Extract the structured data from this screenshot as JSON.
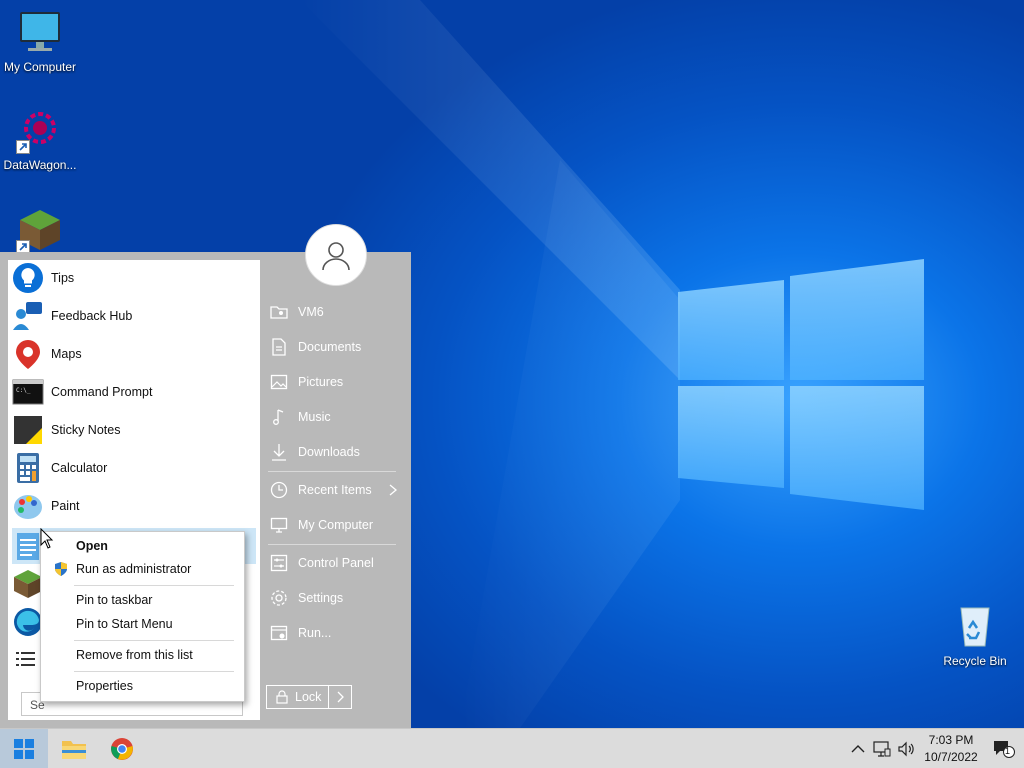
{
  "desktop": {
    "icons": [
      {
        "label": "My Computer"
      },
      {
        "label": "DataWagon..."
      },
      {
        "label": ""
      },
      {
        "label": "Recycle Bin"
      }
    ]
  },
  "start_menu": {
    "programs": [
      {
        "label": "Tips",
        "icon": "tips-icon"
      },
      {
        "label": "Feedback Hub",
        "icon": "feedback-hub-icon"
      },
      {
        "label": "Maps",
        "icon": "maps-icon"
      },
      {
        "label": "Command Prompt",
        "icon": "command-prompt-icon"
      },
      {
        "label": "Sticky Notes",
        "icon": "sticky-notes-icon"
      },
      {
        "label": "Calculator",
        "icon": "calculator-icon"
      },
      {
        "label": "Paint",
        "icon": "paint-icon"
      }
    ],
    "search_text": "Se",
    "right_items": [
      {
        "label": "VM6",
        "icon": "user-folder-icon"
      },
      {
        "label": "Documents",
        "icon": "documents-icon"
      },
      {
        "label": "Pictures",
        "icon": "pictures-icon"
      },
      {
        "label": "Music",
        "icon": "music-icon"
      },
      {
        "label": "Downloads",
        "icon": "downloads-icon"
      },
      {
        "label": "Recent Items",
        "icon": "recent-items-icon"
      },
      {
        "label": "My Computer",
        "icon": "computer-icon"
      },
      {
        "label": "Control Panel",
        "icon": "control-panel-icon"
      },
      {
        "label": "Settings",
        "icon": "settings-icon"
      },
      {
        "label": "Run...",
        "icon": "run-icon"
      }
    ],
    "lock_label": "Lock"
  },
  "context_menu": {
    "items": [
      {
        "label": "Open"
      },
      {
        "label": "Run as administrator"
      },
      {
        "label": "Pin to taskbar"
      },
      {
        "label": "Pin to Start Menu"
      },
      {
        "label": "Remove from this list"
      },
      {
        "label": "Properties"
      }
    ]
  },
  "taskbar": {
    "time": "7:03 PM",
    "date": "10/7/2022",
    "notification_count": "1"
  },
  "colors": {
    "accent": "#0b74e8",
    "start_menu_bg": "#b9b9b9",
    "selection": "#cde6f7"
  }
}
